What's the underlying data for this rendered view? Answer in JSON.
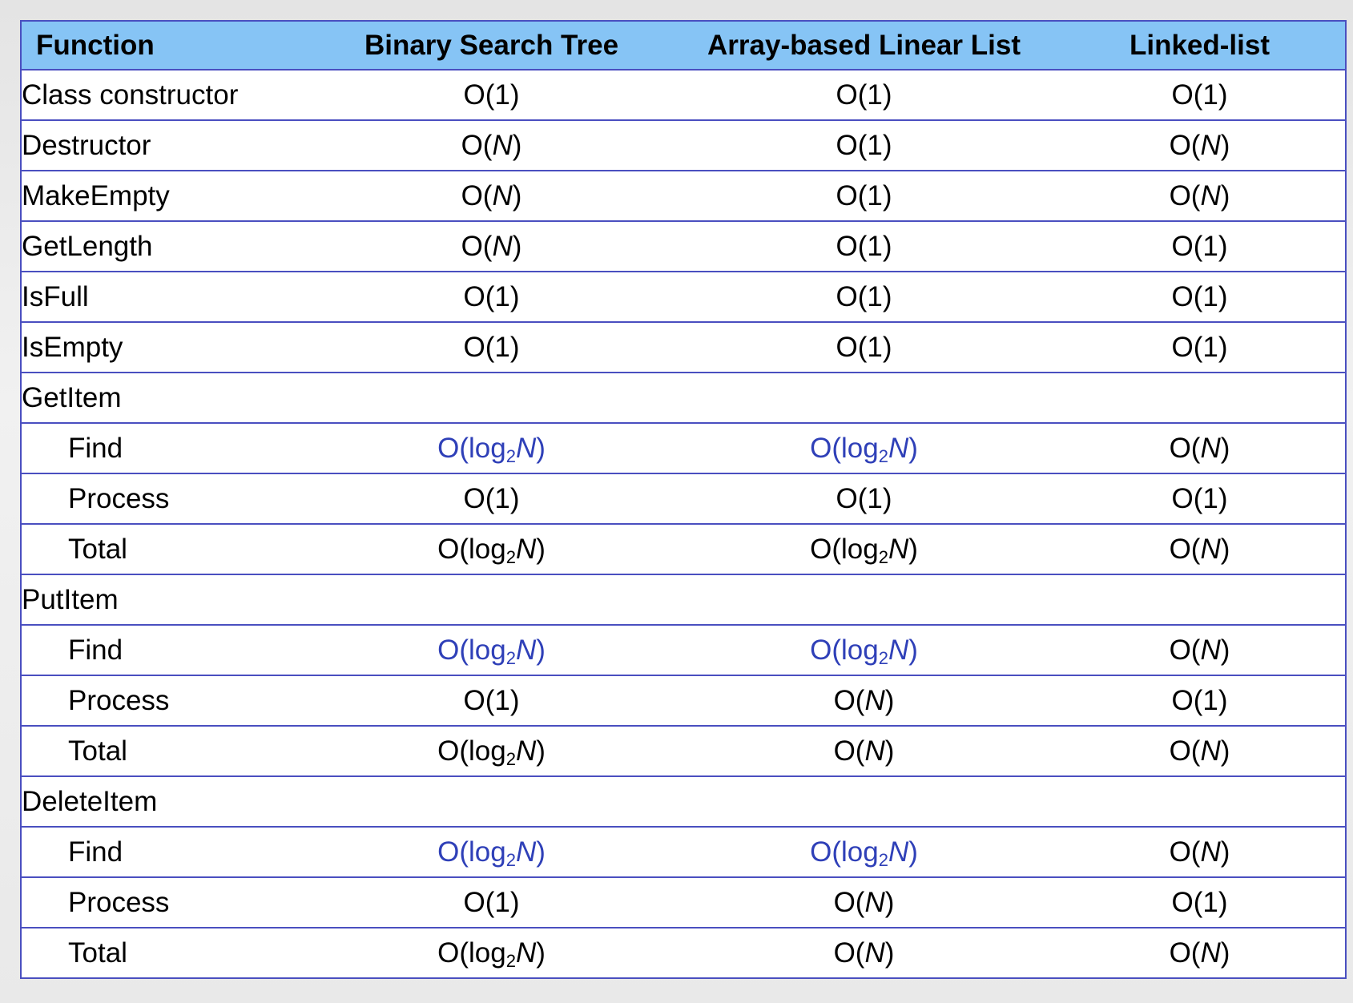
{
  "table": {
    "headers": [
      "Function",
      "Binary Search Tree",
      "Array-based Linear List",
      "Linked-list"
    ],
    "rows": [
      {
        "function": "Class constructor",
        "indent": false,
        "cells": [
          "O(1)",
          "O(1)",
          "O(1)"
        ],
        "highlight": [
          false,
          false,
          false
        ]
      },
      {
        "function": "Destructor",
        "indent": false,
        "cells": [
          "O(N)",
          "O(1)",
          "O(N)"
        ],
        "highlight": [
          false,
          false,
          false
        ]
      },
      {
        "function": "MakeEmpty",
        "indent": false,
        "cells": [
          "O(N)",
          "O(1)",
          "O(N)"
        ],
        "highlight": [
          false,
          false,
          false
        ]
      },
      {
        "function": "GetLength",
        "indent": false,
        "cells": [
          "O(N)",
          "O(1)",
          "O(1)"
        ],
        "highlight": [
          false,
          false,
          false
        ]
      },
      {
        "function": "IsFull",
        "indent": false,
        "cells": [
          "O(1)",
          "O(1)",
          "O(1)"
        ],
        "highlight": [
          false,
          false,
          false
        ]
      },
      {
        "function": "IsEmpty",
        "indent": false,
        "cells": [
          "O(1)",
          "O(1)",
          "O(1)"
        ],
        "highlight": [
          false,
          false,
          false
        ]
      },
      {
        "function": "GetItem",
        "indent": false,
        "cells": [
          "",
          "",
          ""
        ],
        "highlight": [
          false,
          false,
          false
        ]
      },
      {
        "function": "Find",
        "indent": true,
        "cells": [
          "O(log2N)",
          "O(log2N)",
          "O(N)"
        ],
        "highlight": [
          true,
          true,
          false
        ]
      },
      {
        "function": "Process",
        "indent": true,
        "cells": [
          "O(1)",
          "O(1)",
          "O(1)"
        ],
        "highlight": [
          false,
          false,
          false
        ]
      },
      {
        "function": "Total",
        "indent": true,
        "cells": [
          "O(log2N)",
          "O(log2N)",
          "O(N)"
        ],
        "highlight": [
          false,
          false,
          false
        ]
      },
      {
        "function": "PutItem",
        "indent": false,
        "cells": [
          "",
          "",
          ""
        ],
        "highlight": [
          false,
          false,
          false
        ]
      },
      {
        "function": "Find",
        "indent": true,
        "cells": [
          "O(log2N)",
          "O(log2N)",
          "O(N)"
        ],
        "highlight": [
          true,
          true,
          false
        ]
      },
      {
        "function": "Process",
        "indent": true,
        "cells": [
          "O(1)",
          "O(N)",
          "O(1)"
        ],
        "highlight": [
          false,
          false,
          false
        ]
      },
      {
        "function": "Total",
        "indent": true,
        "cells": [
          "O(log2N)",
          "O(N)",
          "O(N)"
        ],
        "highlight": [
          false,
          false,
          false
        ]
      },
      {
        "function": "DeleteItem",
        "indent": false,
        "cells": [
          "",
          "",
          ""
        ],
        "highlight": [
          false,
          false,
          false
        ]
      },
      {
        "function": "Find",
        "indent": true,
        "cells": [
          "O(log2N)",
          "O(log2N)",
          "O(N)"
        ],
        "highlight": [
          true,
          true,
          false
        ]
      },
      {
        "function": "Process",
        "indent": true,
        "cells": [
          "O(1)",
          "O(N)",
          "O(1)"
        ],
        "highlight": [
          false,
          false,
          false
        ]
      },
      {
        "function": "Total",
        "indent": true,
        "cells": [
          "O(log2N)",
          "O(N)",
          "O(N)"
        ],
        "highlight": [
          false,
          false,
          false
        ]
      }
    ]
  },
  "colors": {
    "header_bg": "#86c4f5",
    "border": "#4a4fc0",
    "highlight_text": "#2f40b8",
    "text": "#000000"
  }
}
